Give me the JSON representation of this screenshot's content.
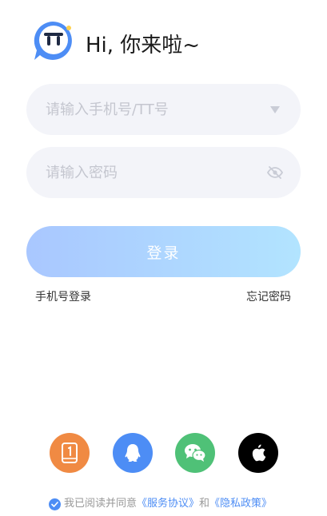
{
  "header": {
    "greeting": "Hi, 你来啦~"
  },
  "form": {
    "phone_placeholder": "请输入手机号/TT号",
    "password_placeholder": "请输入密码",
    "login_label": "登录"
  },
  "links": {
    "phone_login": "手机号登录",
    "forgot_password": "忘记密码"
  },
  "social": [
    {
      "name": "phone-login",
      "icon": "phone-icon",
      "color": "#f08a43"
    },
    {
      "name": "qq",
      "icon": "qq-icon",
      "color": "#4d8df5"
    },
    {
      "name": "wechat",
      "icon": "wechat-icon",
      "color": "#4fc177"
    },
    {
      "name": "apple",
      "icon": "apple-icon",
      "color": "#000000"
    }
  ],
  "agreement": {
    "prefix": "我已阅读并同意",
    "service": "《服务协议》",
    "and": "和",
    "privacy": "《隐私政策》"
  },
  "colors": {
    "accent": "#4d8df5",
    "field_bg": "#f3f4f9",
    "button_gradient_start": "#a9c7ff",
    "button_gradient_end": "#b2e4ff"
  }
}
